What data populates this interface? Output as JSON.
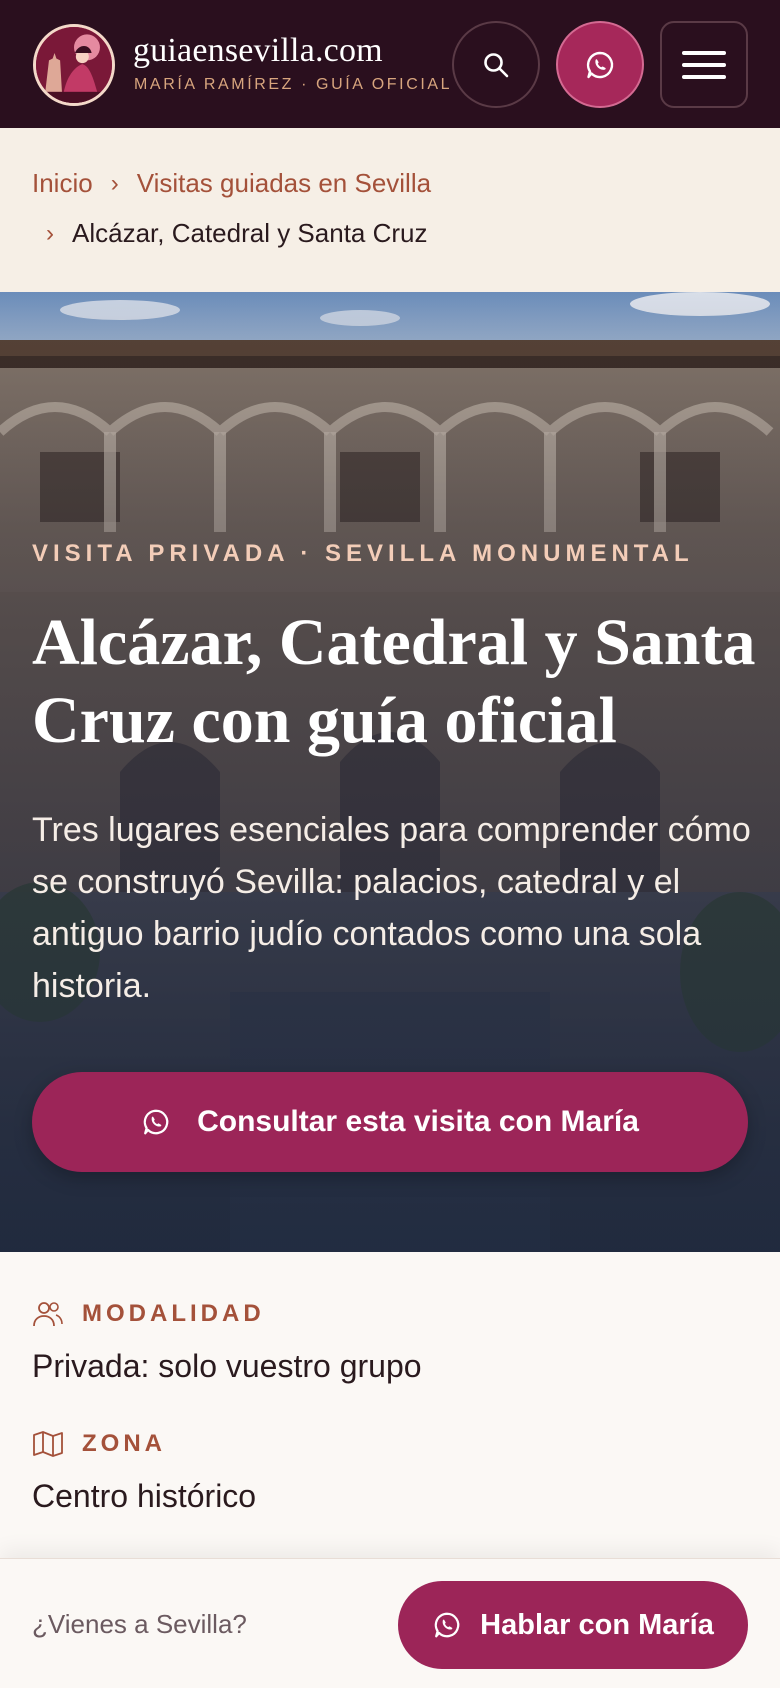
{
  "header": {
    "site_name": "guiaensevilla.com",
    "site_subtitle": "MARÍA RAMÍREZ · GUÍA OFICIAL",
    "search_icon": "search-icon",
    "whatsapp_icon": "whatsapp-icon",
    "menu_icon": "hamburger-menu-icon"
  },
  "breadcrumb": {
    "items": [
      "Inicio",
      "Visitas guiadas en Sevilla",
      "Alcázar, Catedral y Santa Cruz"
    ],
    "separator": "›"
  },
  "hero": {
    "eyebrow": "VISITA PRIVADA · SEVILLA MONUMENTAL",
    "title": "Alcázar, Catedral y Santa Cruz con guía oficial",
    "description": "Tres lugares esenciales para comprender cómo se construyó Sevilla: palacios, catedral y el antiguo barrio judío contados como una sola historia.",
    "cta_label": "Consultar esta visita con María"
  },
  "info": {
    "items": [
      {
        "label": "MODALIDAD",
        "value": "Privada: solo vuestro grupo",
        "icon": "group-icon"
      },
      {
        "label": "ZONA",
        "value": "Centro histórico",
        "icon": "map-icon"
      }
    ]
  },
  "bottom_bar": {
    "text": "¿Vienes a Sevilla?",
    "button_label": "Hablar con María"
  },
  "colors": {
    "header_bg": "#2a0f1e",
    "accent": "#9c2558",
    "label_accent": "#a4513a",
    "eyebrow": "#f3cdb8"
  }
}
